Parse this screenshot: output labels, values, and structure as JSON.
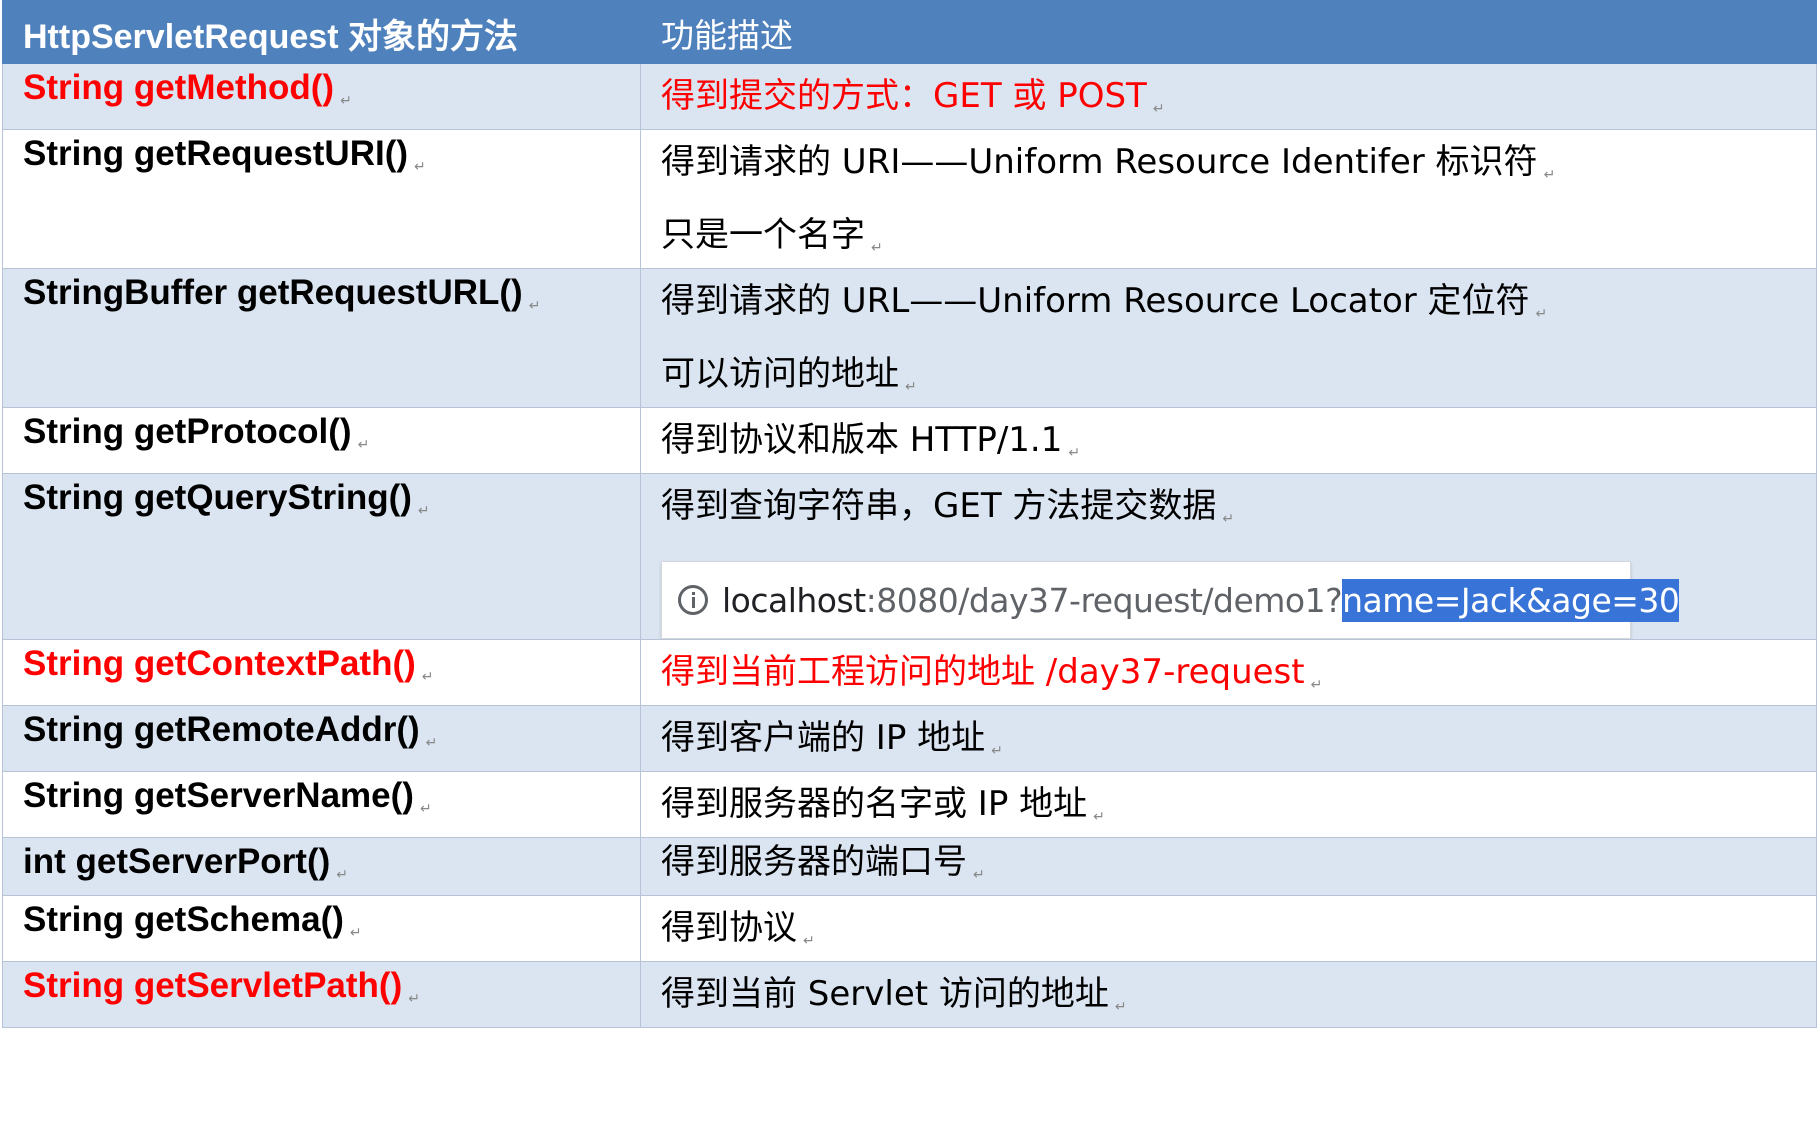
{
  "header": {
    "col1": "HttpServletRequest 对象的方法",
    "col2": "功能描述"
  },
  "paragraph_mark": "↵",
  "rows": [
    {
      "method": "String getMethod()",
      "desc": "得到提交的方式：GET 或 POST",
      "highlight": true
    },
    {
      "method": "String getRequestURI()",
      "desc": "得到请求的 URI——Uniform Resource Identifer  标识符",
      "desc2": "只是一个名字"
    },
    {
      "method": "StringBuffer getRequestURL()",
      "desc": "得到请求的 URL——Uniform Resource Locator  定位符",
      "desc2": "可以访问的地址"
    },
    {
      "method": "String getProtocol()",
      "desc": "得到协议和版本  HTTP/1.1"
    },
    {
      "method": "String getQueryString()",
      "desc": "得到查询字符串，GET 方法提交数据"
    },
    {
      "method": "String getContextPath()",
      "desc": "得到当前工程访问的地址  /day37-request",
      "highlight": true
    },
    {
      "method": "String getRemoteAddr()",
      "desc": "得到客户端的 IP 地址"
    },
    {
      "method": "String getServerName()",
      "desc": "得到服务器的名字或 IP 地址"
    },
    {
      "method": "int getServerPort()",
      "desc": "得到服务器的端口号"
    },
    {
      "method": "String getSchema()",
      "desc": "得到协议"
    },
    {
      "method": "String getServletPath()",
      "desc": "得到当前 Servlet 访问的地址",
      "method_highlight": true
    }
  ],
  "url_example": {
    "host": "localhost",
    "path": ":8080/day37-request/demo1?",
    "query": "name=Jack&age=30"
  }
}
